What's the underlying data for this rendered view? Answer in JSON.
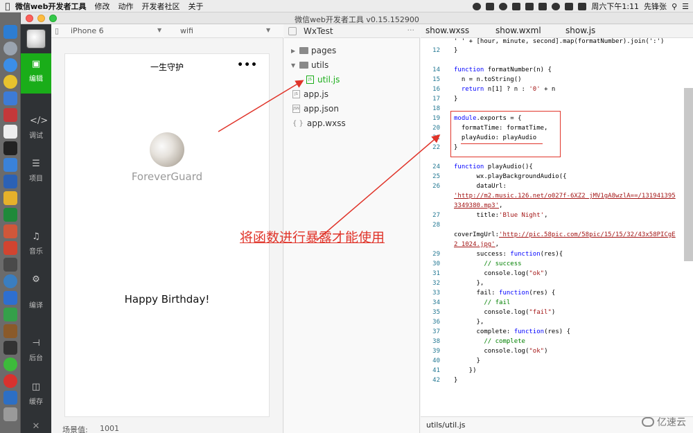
{
  "menubar": {
    "app_name": "微信web开发者工具",
    "items": [
      "修改",
      "动作",
      "开发者社区",
      "关于"
    ],
    "clock": "周六下午1:11",
    "user": "先锋张"
  },
  "window": {
    "title": "微信web开发者工具 v0.15.152900"
  },
  "toolbar": {
    "items": [
      {
        "label": "编辑",
        "icon": "code-icon"
      },
      {
        "label": "调试",
        "icon": "debug-icon"
      },
      {
        "label": "项目",
        "icon": "project-icon"
      },
      {
        "label": "音乐",
        "icon": "music-icon"
      },
      {
        "label": "编译",
        "icon": "compile-icon"
      },
      {
        "label": "后台",
        "icon": "background-icon"
      },
      {
        "label": "缓存",
        "icon": "cache-icon"
      }
    ],
    "close": "✕"
  },
  "simulator": {
    "device": "iPhone 6",
    "network": "wifi",
    "nav_title": "一生守护",
    "menu_dots": "•••",
    "username": "ForeverGuard",
    "greeting": "Happy Birthday!",
    "scene_label": "场景值:",
    "scene_value": "1001"
  },
  "files": {
    "project": "WxTest",
    "more": "···",
    "tree": [
      {
        "name": "pages",
        "type": "folder"
      },
      {
        "name": "utils",
        "type": "folder"
      },
      {
        "name": "util.js",
        "type": "js"
      },
      {
        "name": "app.js",
        "type": "js"
      },
      {
        "name": "app.json",
        "type": "json"
      },
      {
        "name": "app.wxss",
        "type": "wxss"
      }
    ]
  },
  "editor": {
    "tabs": [
      "show.wxss",
      "show.wxml",
      "show.js"
    ],
    "path": "utils/util.js"
  },
  "annotation": {
    "note": "将函数进行暴露才能使用"
  },
  "watermark": "亿速云",
  "colors": {
    "accent_green": "#1aad19",
    "annotation_red": "#e0342a"
  }
}
